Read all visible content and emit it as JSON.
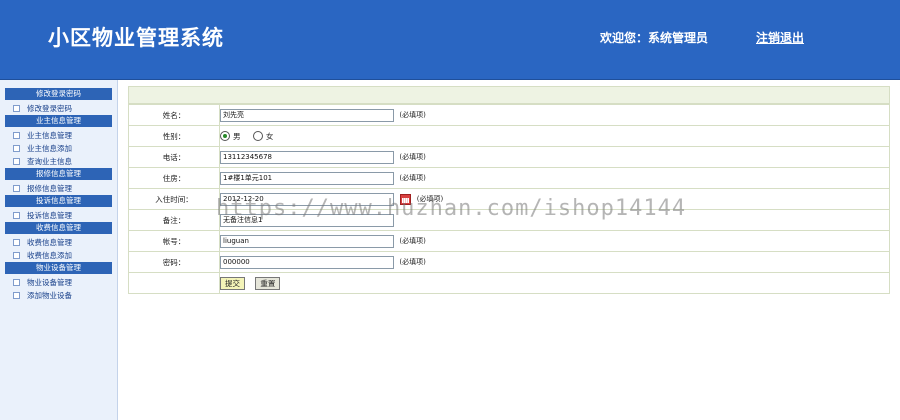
{
  "header": {
    "title": "小区物业管理系统",
    "welcome": "欢迎您：系统管理员",
    "logout": "注销退出"
  },
  "sidebar": {
    "groups": [
      {
        "title": "修改登录密码",
        "items": [
          "修改登录密码"
        ]
      },
      {
        "title": "业主信息管理",
        "items": [
          "业主信息管理",
          "业主信息添加",
          "查询业主信息"
        ]
      },
      {
        "title": "报修信息管理",
        "items": [
          "报修信息管理"
        ]
      },
      {
        "title": "投诉信息管理",
        "items": [
          "投诉信息管理"
        ]
      },
      {
        "title": "收费信息管理",
        "items": [
          "收费信息管理",
          "收费信息添加"
        ]
      },
      {
        "title": "物业设备管理",
        "items": [
          "物业设备管理",
          "添加物业设备"
        ]
      }
    ]
  },
  "form": {
    "name": {
      "label": "姓名：",
      "value": "刘先亮",
      "hint": "(必填项)"
    },
    "gender": {
      "label": "性别：",
      "male": "男",
      "female": "女",
      "selected": "男"
    },
    "phone": {
      "label": "电话：",
      "value": "13112345678",
      "hint": "(必填项)"
    },
    "residence": {
      "label": "住房：",
      "value": "1#楼1单元101",
      "hint": "(必填项)"
    },
    "move_in": {
      "label": "入住时间：",
      "value": "2012-12-20",
      "hint": "(必填项)"
    },
    "remark": {
      "label": "备注：",
      "value": "无备注信息1"
    },
    "account": {
      "label": "帐号：",
      "value": "liuguan",
      "hint": "(必填项)"
    },
    "password": {
      "label": "密码：",
      "value": "000000",
      "hint": "(必填项)"
    },
    "submit": "提交",
    "reset": "重置"
  },
  "watermark": "https://www.huzhan.com/ishop14144",
  "colors": {
    "header": "#2a66c2",
    "sidebar_group": "#2d64b6",
    "form_border": "#d6dec4"
  }
}
